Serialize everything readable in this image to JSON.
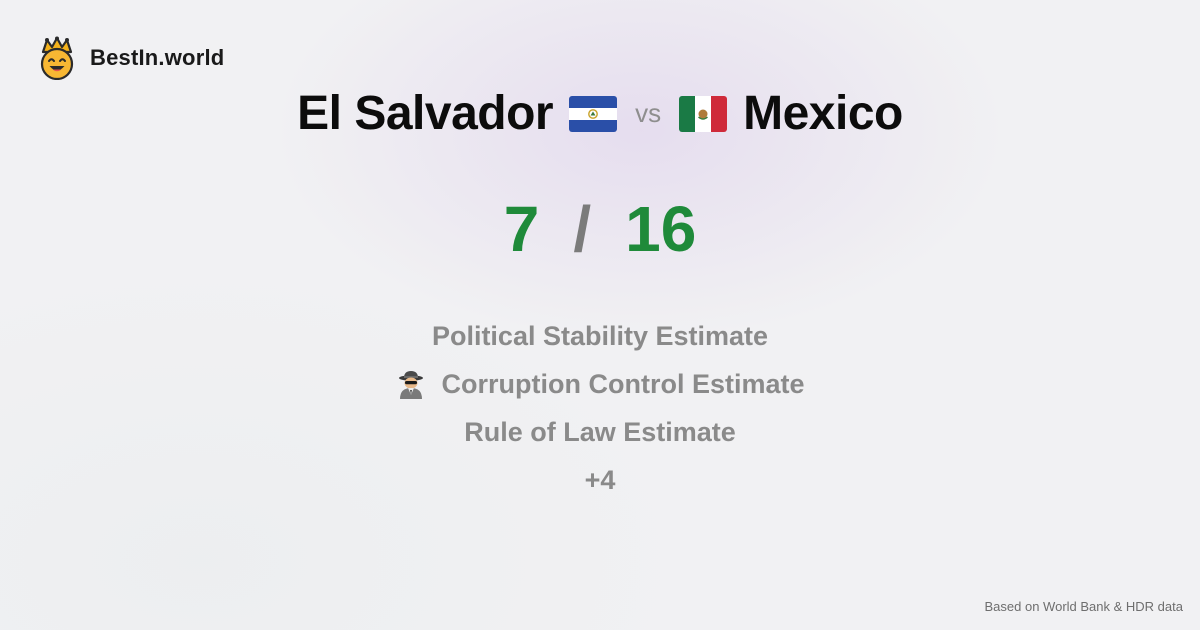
{
  "brand": {
    "name": "BestIn.world",
    "logo_icon": "crown-smiley-icon"
  },
  "matchup": {
    "left_country": "El Salvador",
    "left_flag_icon": "el-salvador-flag-icon",
    "vs_label": "vs",
    "right_country": "Mexico",
    "right_flag_icon": "mexico-flag-icon"
  },
  "score": {
    "left": "7",
    "separator": "/",
    "right": "16",
    "color": "#1f8a3a"
  },
  "metrics": [
    {
      "label": "Political Stability Estimate"
    },
    {
      "label": "Corruption Control Estimate",
      "icon": "detective-icon"
    },
    {
      "label": "Rule of Law Estimate"
    },
    {
      "label": "+4"
    }
  ],
  "footer": {
    "source_text": "Based on World Bank & HDR data"
  }
}
